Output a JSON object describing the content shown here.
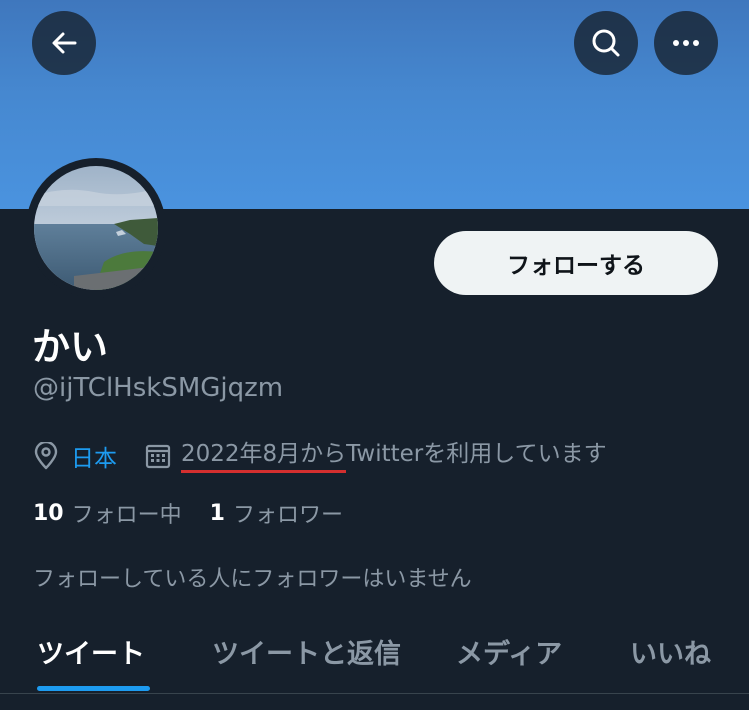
{
  "header": {
    "back_icon": "arrow-left-icon",
    "search_icon": "search-icon",
    "more_icon": "more-horizontal-icon"
  },
  "colors": {
    "background": "#16202c",
    "banner": "#4a93df",
    "accent": "#1d9bf0",
    "muted_text": "#8b98a5",
    "highlight_underline": "#d32f2f"
  },
  "profile": {
    "display_name": "かい",
    "handle": "@ijTClHskSMGjqzm",
    "follow_button": "フォローする",
    "location": "日本",
    "joined_date": "2022年8月から",
    "joined_rest": "Twitterを利用しています",
    "following_count": "10",
    "following_label": "フォロー中",
    "followers_count": "1",
    "followers_label": "フォロワー",
    "known_followers": "フォローしている人にフォロワーはいません"
  },
  "tabs": [
    {
      "label": "ツイート",
      "active": true
    },
    {
      "label": "ツイートと返信",
      "active": false
    },
    {
      "label": "メディア",
      "active": false
    },
    {
      "label": "いいね",
      "active": false
    }
  ]
}
